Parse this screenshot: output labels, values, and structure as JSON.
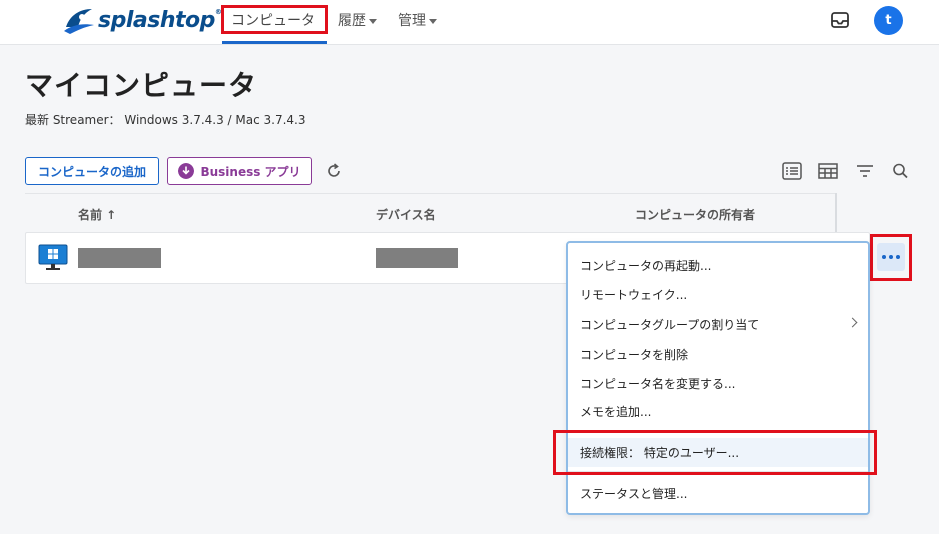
{
  "header": {
    "logo_text": "splashtop",
    "logo_mark": "®",
    "nav": [
      {
        "label": "コンピュータ"
      },
      {
        "label": "履歴"
      },
      {
        "label": "管理"
      }
    ],
    "avatar_initial": "t"
  },
  "page": {
    "title": "マイコンピュータ",
    "version_text": "最新 Streamer： Windows 3.7.4.3 / Mac 3.7.4.3"
  },
  "toolbar": {
    "add_label": "コンピュータの追加",
    "business_label": "Business アプリ"
  },
  "table": {
    "columns": [
      "名前 ↑",
      "デバイス名",
      "コンピュータの所有者"
    ]
  },
  "menu": {
    "items": [
      {
        "label": "コンピュータの再起動..."
      },
      {
        "label": "リモートウェイク..."
      },
      {
        "label": "コンピュータグループの割り当て"
      },
      {
        "label": "コンピュータを削除"
      },
      {
        "label": "コンピュータ名を変更する..."
      },
      {
        "label": "メモを追加..."
      },
      {
        "label": "接続権限： 特定のユーザー..."
      },
      {
        "label": "ステータスと管理..."
      }
    ]
  },
  "colors": {
    "accent": "#1a66c9",
    "business": "#8a3b97",
    "highlight": "#e0101c"
  }
}
